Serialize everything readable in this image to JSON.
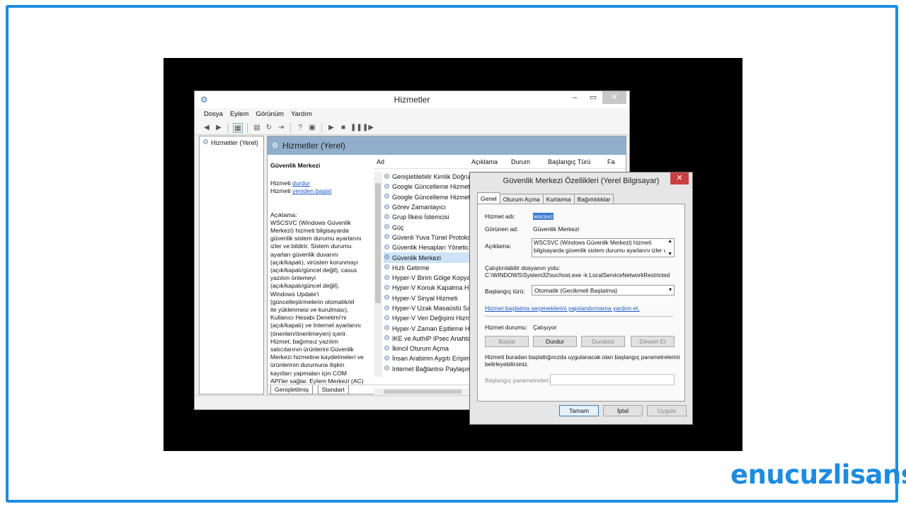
{
  "services_window": {
    "title": "Hizmetler",
    "menu": [
      "Dosya",
      "Eylem",
      "Görünüm",
      "Yardım"
    ],
    "tree_item": "Hizmetler (Yerel)",
    "panel_header": "Hizmetler (Yerel)",
    "selected_service": {
      "name": "Güvenlik Merkezi",
      "stop_prefix": "Hizmeti",
      "stop_link": "durdur",
      "restart_prefix": "Hizmeti",
      "restart_link": "yeniden başlat",
      "desc_label": "Açıklama:",
      "desc_lines": [
        "WSCSVC (Windows Güvenlik",
        "Merkezi) hizmeti bilgisayarda",
        "güvenlik sistem durumu ayarlarını",
        "izler ve bildirir. Sistem durumu",
        "ayarları güvenlik duvarını",
        "(açık/kapalı), virüsten korunmayı",
        "(açık/kapalı/güncel değil), casus",
        "yazılım önlemeyi",
        "(açık/kapalı/güncel değil),",
        "Windows Update'i",
        "(güncelleştirmelerin otomatik/el",
        "ile yüklenmesi ve kurulması),",
        "Kullanıcı Hesabı Denetimi'ni",
        "(açık/kapalı) ve Internet ayarlarını",
        "(önerilen/önerilmeyen) içerir.",
        "Hizmet, bağımsız yazılım",
        "satıcılarının ürünlerini Güvenlik",
        "Merkezi hizmetine kaydetmeleri ve",
        "ürünlerinin durumuna ilişkin",
        "kayıtları yapmaları için COM",
        "API'ler sağlar. Eylem Merkezi (AC)"
      ]
    },
    "columns": [
      "Ad",
      "Açıklama",
      "Durum",
      "Başlangıç Türü",
      "Fa"
    ],
    "services": [
      "Genişletilebilir Kimlik Doğru...",
      "Google Güncelleme Hizmet...",
      "Google Güncelleme Hizmet...",
      "Görev Zamanlayıcı",
      "Grup İlkesi İstemcisi",
      "Güç",
      "Güvenli Yuva Tünel Protoko...",
      "Güvenlik Hesapları Yönetici...",
      "Güvenlik Merkezi",
      "Hızlı Getirme",
      "Hyper-V Birim Gölge Kopya...",
      "Hyper-V Konuk Kapatma Hi...",
      "Hyper-V Sinyal Hizmeti",
      "Hyper-V Uzak Masaüstü Sa...",
      "Hyper-V Veri Değişimi Hizm...",
      "Hyper-V Zaman Eşitleme Hi...",
      "IKE ve AuthIP IPsec Anahtar...",
      "İkincil Oturum Açma",
      "İnsan Arabirim Aygıtı Erişimi",
      "Internet Bağlantısı Paylaşım..."
    ],
    "selected_index": 8,
    "bottom_tabs": [
      "Genişletilmiş",
      "Standart"
    ]
  },
  "dialog": {
    "title": "Güvenlik Merkezi Özellikleri (Yerel Bilgisayar)",
    "tabs": [
      "Genel",
      "Oturum Açma",
      "Kurtarma",
      "Bağımlılıklar"
    ],
    "service_name_label": "Hizmet adı:",
    "service_name": "wscsvc",
    "display_name_label": "Görünen ad:",
    "display_name": "Güvenlik Merkezi",
    "description_label": "Açıklama:",
    "description_line1": "WSCSVC (Windows Güvenlik Merkezi) hizmeti",
    "description_line2": "bilgisayarda güvenlik sistem durumu ayarlarını izler ve",
    "exe_label": "Çalıştırılabilir dosyanın yolu:",
    "exe_path": "C:\\WINDOWS\\System32\\svchost.exe -k LocalServiceNetworkRestricted",
    "startup_type_label": "Başlangıç türü:",
    "startup_type_value": "Otomatik (Gecikmeli Başlatma)",
    "help_link": "Hizmet başlatma seçeneklerini yapılandırmama yardım et.",
    "status_label": "Hizmet durumu:",
    "status_value": "Çalışıyor",
    "buttons": {
      "start": "Başlat",
      "stop": "Durdur",
      "pause": "Duraklat",
      "resume": "Devam Et"
    },
    "params_note_line1": "Hizmeti buradan başlattığınızda uygulanacak olan başlangıç parametrelerini",
    "params_note_line2": "belirleyebilirsiniz.",
    "params_label": "Başlangıç parametreleri:",
    "params_value": "",
    "footer": {
      "ok": "Tamam",
      "cancel": "İptal",
      "apply": "Uygula"
    }
  },
  "brand": "enucuzlisans",
  "colors": {
    "frame": "#1d8ce0",
    "panel_header": "#91afcc",
    "selection": "#3b78d0"
  }
}
